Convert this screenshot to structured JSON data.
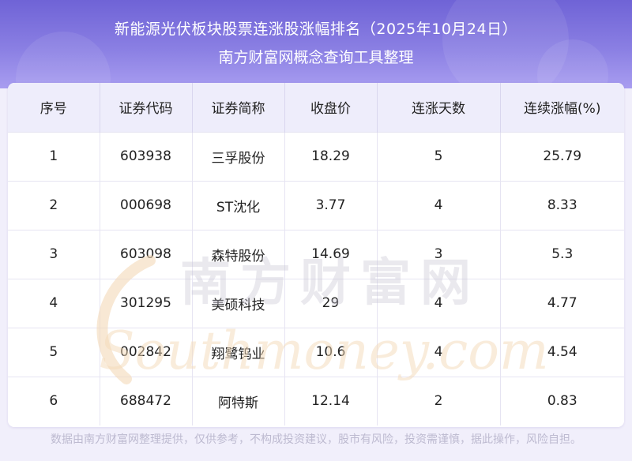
{
  "header": {
    "title_line1": "新能源光伏板块股票连涨股涨幅排名（2025年10月24日）",
    "title_line2": "南方财富网概念查询工具整理"
  },
  "table": {
    "columns": [
      "序号",
      "证券代码",
      "证券简称",
      "收盘价",
      "连涨天数",
      "连续涨幅(%)"
    ],
    "rows": [
      [
        "1",
        "603938",
        "三孚股份",
        "18.29",
        "5",
        "25.79"
      ],
      [
        "2",
        "000698",
        "ST沈化",
        "3.77",
        "4",
        "8.33"
      ],
      [
        "3",
        "603098",
        "森特股份",
        "14.69",
        "3",
        "5.3"
      ],
      [
        "4",
        "301295",
        "美硕科技",
        "29",
        "4",
        "4.77"
      ],
      [
        "5",
        "002842",
        "翔鹭钨业",
        "10.6",
        "4",
        "4.54"
      ],
      [
        "6",
        "688472",
        "阿特斯",
        "12.14",
        "2",
        "0.83"
      ]
    ]
  },
  "watermark": {
    "cn": "南方财富网",
    "en": "Southmoney.com"
  },
  "footer": {
    "disclaimer": "数据由南方财富网整理提供，仅供参考，不构成投资建议，股市有风险，投资需谨慎，据此操作，风险自担。"
  },
  "colors": {
    "header_gradient_top": "#6f63d6",
    "header_gradient_bottom": "#a89df0",
    "table_header_bg": "#eeedfb",
    "watermark_orange": "#f3d9b8"
  }
}
